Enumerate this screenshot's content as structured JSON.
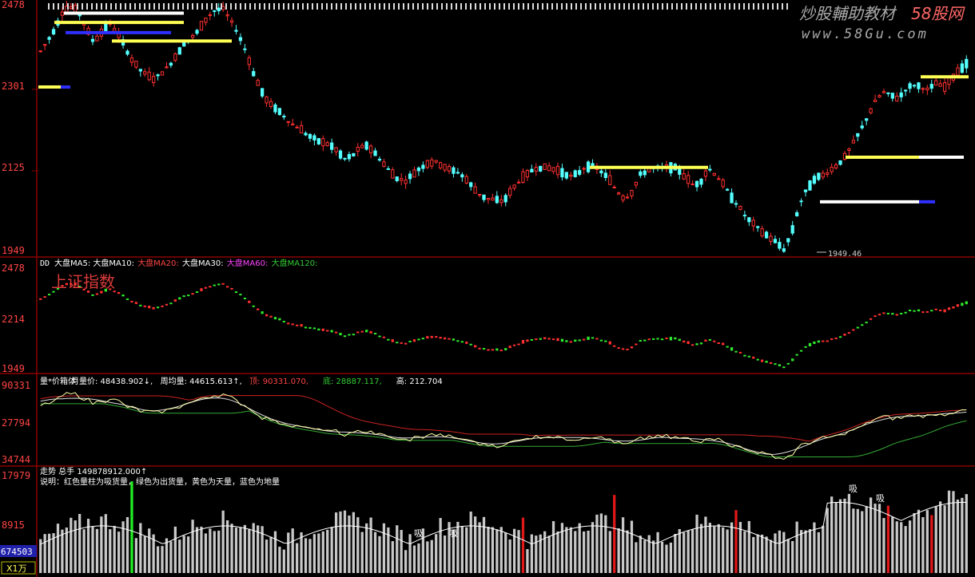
{
  "watermark": {
    "title": "炒股輔助教材",
    "brand": "58股网",
    "url": "www.58Gu.com"
  },
  "colors": {
    "up": "#ff3030",
    "down_main": "#54ffff",
    "down_sub": "#2eea2e",
    "border": "#8a0000",
    "axis_text": "#ff4444",
    "yellow": "#ffff54",
    "white": "#ffffff",
    "blue": "#2f2fff",
    "pink": "#ff44ff",
    "gray_bar": "#c8c8c8"
  },
  "panel1": {
    "ticks": [
      "2478",
      "2301",
      "2125",
      "1949"
    ],
    "low_annotation": "1949.46"
  },
  "panel2": {
    "title_prefix": "DD",
    "legend": [
      {
        "text": "大盘MA5:",
        "color": "#ffffff"
      },
      {
        "text": "大盘MA10:",
        "color": "#ffffff"
      },
      {
        "text": "大盘MA20:",
        "color": "#ff4444"
      },
      {
        "text": "大盘MA30:",
        "color": "#ffffff"
      },
      {
        "text": "大盘MA60:",
        "color": "#ff44ff"
      },
      {
        "text": "大盘MA120:",
        "color": "#33cc33"
      }
    ],
    "overlay_text": "上证指数",
    "ticks": [
      "2478",
      "2214",
      "1949"
    ]
  },
  "panel3": {
    "legend": [
      {
        "text": "量*价箱体",
        "color": "#ffffff"
      },
      {
        "text": "月量价: 48438.902↓,",
        "color": "#ffffff"
      },
      {
        "text": "周均量: 44615.613↑,",
        "color": "#ffffff"
      },
      {
        "text": "顶: 90331.070,",
        "color": "#ff4444"
      },
      {
        "text": "底: 28887.117,",
        "color": "#33cc33"
      },
      {
        "text": "高: 212.704",
        "color": "#ffffff"
      }
    ],
    "ticks": [
      "90331",
      "27794",
      "34744"
    ]
  },
  "panel4": {
    "legend_line1": "走势 总手 149878912.000↑",
    "legend_line2": "说明：红色量柱为吸货量，绿色为出货量，黄色为天量，蓝色为地量",
    "ticks": [
      "17979",
      "8915"
    ],
    "current_value": "674503",
    "unit_label": "X1万",
    "absorb_label": "吸"
  },
  "chart_data": {
    "type": "candlestick",
    "candle_count": 214,
    "price_axis": {
      "min": 1949,
      "max": 2478
    },
    "low": 1949.46,
    "price_path": [
      2378,
      2402,
      2430,
      2466,
      2472,
      2462,
      2428,
      2398,
      2418,
      2440,
      2420,
      2392,
      2360,
      2340,
      2326,
      2318,
      2332,
      2348,
      2372,
      2398,
      2408,
      2426,
      2452,
      2466,
      2470,
      2445,
      2418,
      2380,
      2334,
      2296,
      2266,
      2256,
      2240,
      2222,
      2214,
      2200,
      2190,
      2182,
      2178,
      2165,
      2146,
      2152,
      2168,
      2176,
      2160,
      2140,
      2120,
      2105,
      2098,
      2112,
      2127,
      2137,
      2140,
      2132,
      2122,
      2118,
      2104,
      2084,
      2068,
      2060,
      2058,
      2055,
      2077,
      2098,
      2110,
      2126,
      2128,
      2126,
      2122,
      2116,
      2108,
      2118,
      2132,
      2130,
      2118,
      2100,
      2076,
      2060,
      2076,
      2112,
      2122,
      2128,
      2126,
      2130,
      2124,
      2106,
      2090,
      2098,
      2126,
      2112,
      2090,
      2066,
      2044,
      2020,
      2005,
      1990,
      1978,
      1966,
      1951,
      1990,
      2048,
      2082,
      2105,
      2110,
      2120,
      2134,
      2150,
      2178,
      2206,
      2238,
      2270,
      2290,
      2284,
      2276,
      2296,
      2306,
      2302,
      2294,
      2310,
      2298,
      2318,
      2338,
      2352
    ],
    "volume_axis": {
      "min": 0,
      "max": 17979
    },
    "volume_current": 674503
  }
}
